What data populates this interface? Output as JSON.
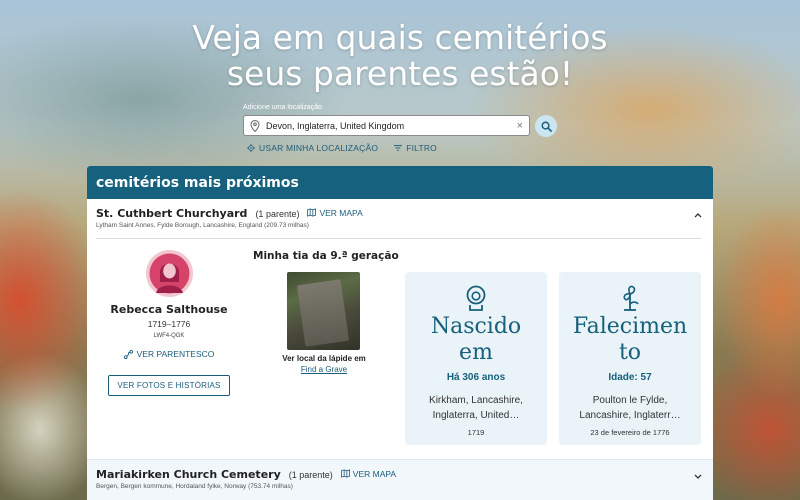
{
  "hero": {
    "line1": "Veja em quais cemitérios",
    "line2": "seus parentes estão!"
  },
  "search": {
    "label": "Adicione uma localização",
    "value": "Devon, Inglaterra, United Kingdom",
    "clear_icon": "×",
    "use_location": "USAR MINHA LOCALIZAÇÃO",
    "filter": "FILTRO"
  },
  "panel": {
    "title": "cemitérios mais próximos"
  },
  "cemeteries": [
    {
      "name": "St. Cuthbert Churchyard",
      "count": "(1 parente)",
      "map_label": "VER MAPA",
      "address": "Lytham Saint Annes, Fylde Borough, Lancashire, England (209.73 milhas)",
      "expanded": true
    },
    {
      "name": "Mariakirken Church Cemetery",
      "count": "(1 parente)",
      "map_label": "VER MAPA",
      "address": "Bergen, Bergen kommune, Hordaland fylke, Norway (753.74 milhas)",
      "expanded": false
    }
  ],
  "person": {
    "name": "Rebecca Salthouse",
    "dates": "1719–1776",
    "id": "LWF4-QGK",
    "relationship_link": "VER PARENTESCO",
    "photos_button": "VER FOTOS E HISTÓRIAS",
    "relation": "Minha tia da 9.ª geração"
  },
  "grave": {
    "caption": "Ver local da lápide em",
    "link": "Find a Grave"
  },
  "birth": {
    "title_line1": "Nascido",
    "title_line2": "em",
    "ago": "Há 306 anos",
    "place_line1": "Kirkham, Lancashire,",
    "place_line2": "Inglaterra, United…",
    "date": "1719"
  },
  "death": {
    "title_line1": "Falecimen",
    "title_line2": "to",
    "age": "Idade: 57",
    "place_line1": "Poulton le Fylde,",
    "place_line2": "Lancashire, Inglaterr…",
    "date": "23 de fevereiro de 1776"
  },
  "colors": {
    "header": "#16617e",
    "link": "#1c5c7a",
    "card_bg": "#eaf4f8",
    "avatar_bg": "#f2c6cf"
  }
}
